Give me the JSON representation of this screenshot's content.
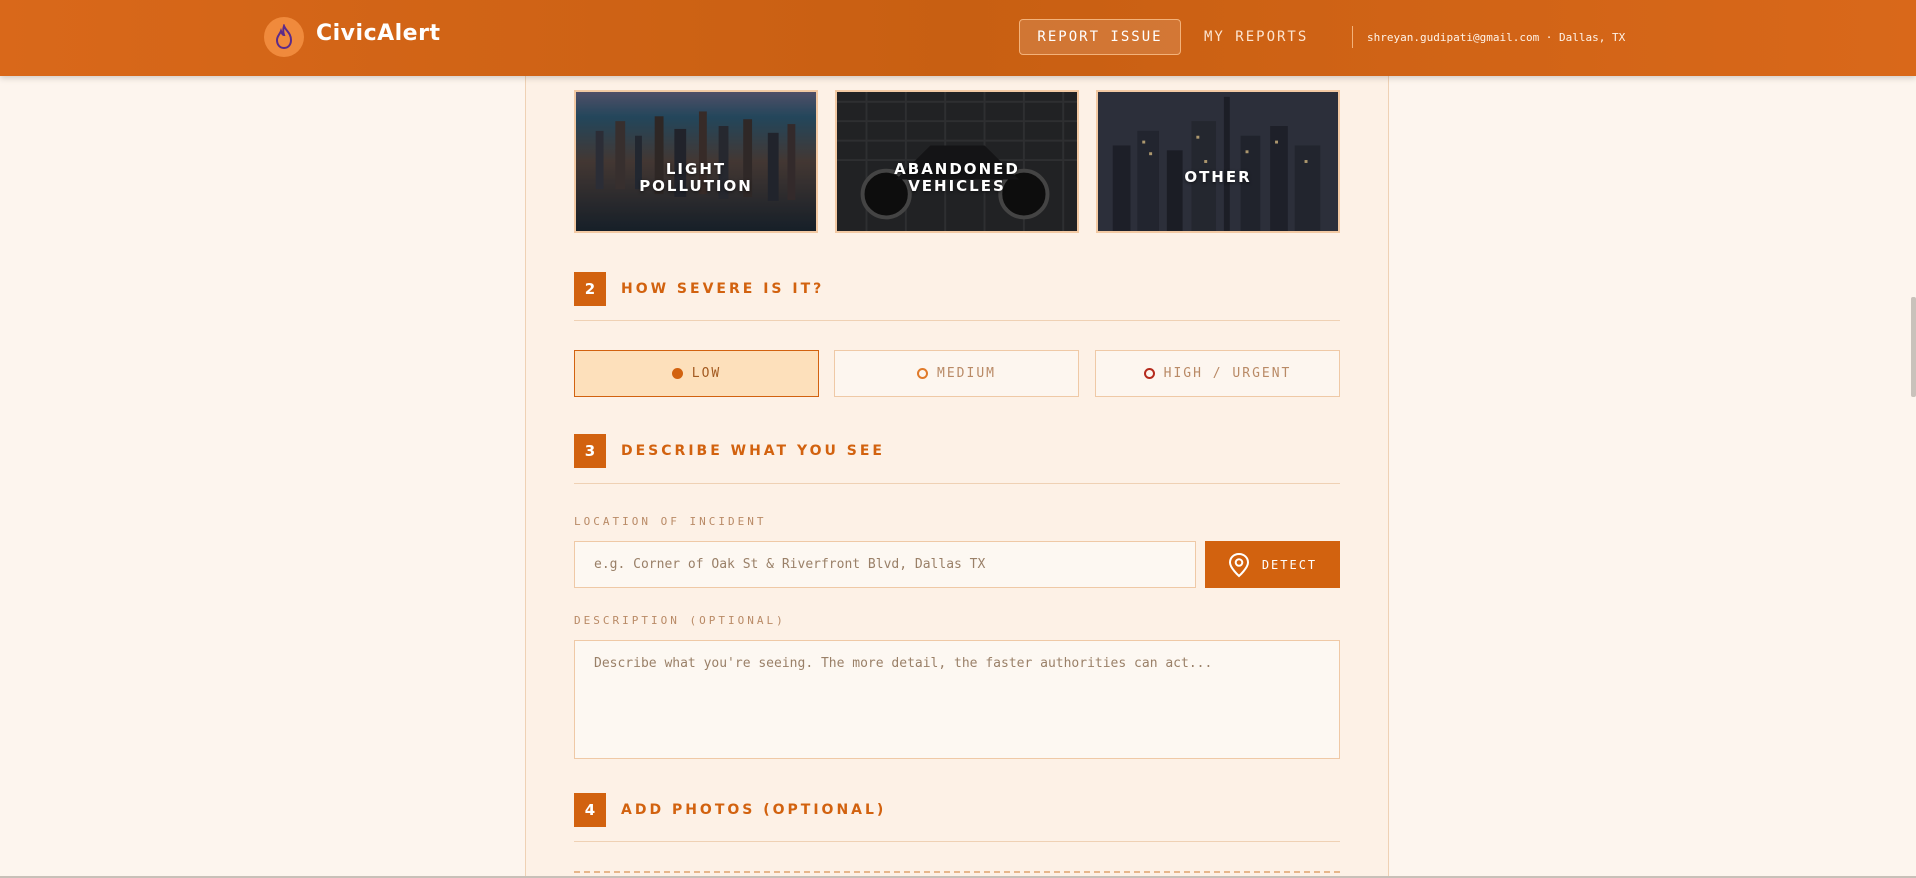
{
  "header": {
    "brand": "CivicAlert",
    "nav_report": "REPORT ISSUE",
    "nav_my_reports": "MY REPORTS",
    "user_info": "shreyan.gudipati@gmail.com · Dallas, TX"
  },
  "categories": [
    {
      "label": "LIGHT POLLUTION"
    },
    {
      "label": "ABANDONED VEHICLES"
    },
    {
      "label": "OTHER"
    }
  ],
  "step2": {
    "num": "2",
    "title": "HOW SEVERE IS IT?"
  },
  "severity": {
    "options": [
      {
        "label": "LOW",
        "selected": true,
        "color": "#d2620f"
      },
      {
        "label": "MEDIUM",
        "selected": false,
        "color": "#e07a2a"
      },
      {
        "label": "HIGH / URGENT",
        "selected": false,
        "color": "#b52a1c"
      }
    ]
  },
  "step3": {
    "num": "3",
    "title": "DESCRIBE WHAT YOU SEE"
  },
  "location": {
    "label": "LOCATION OF INCIDENT",
    "placeholder": "e.g. Corner of Oak St & Riverfront Blvd, Dallas TX",
    "detect_label": "DETECT"
  },
  "description": {
    "label": "DESCRIPTION (OPTIONAL)",
    "placeholder": "Describe what you're seeing. The more detail, the faster authorities can act..."
  },
  "step4": {
    "num": "4",
    "title": "ADD PHOTOS (OPTIONAL)"
  },
  "colors": {
    "accent": "#d2620f",
    "background": "#fdf5ee"
  }
}
